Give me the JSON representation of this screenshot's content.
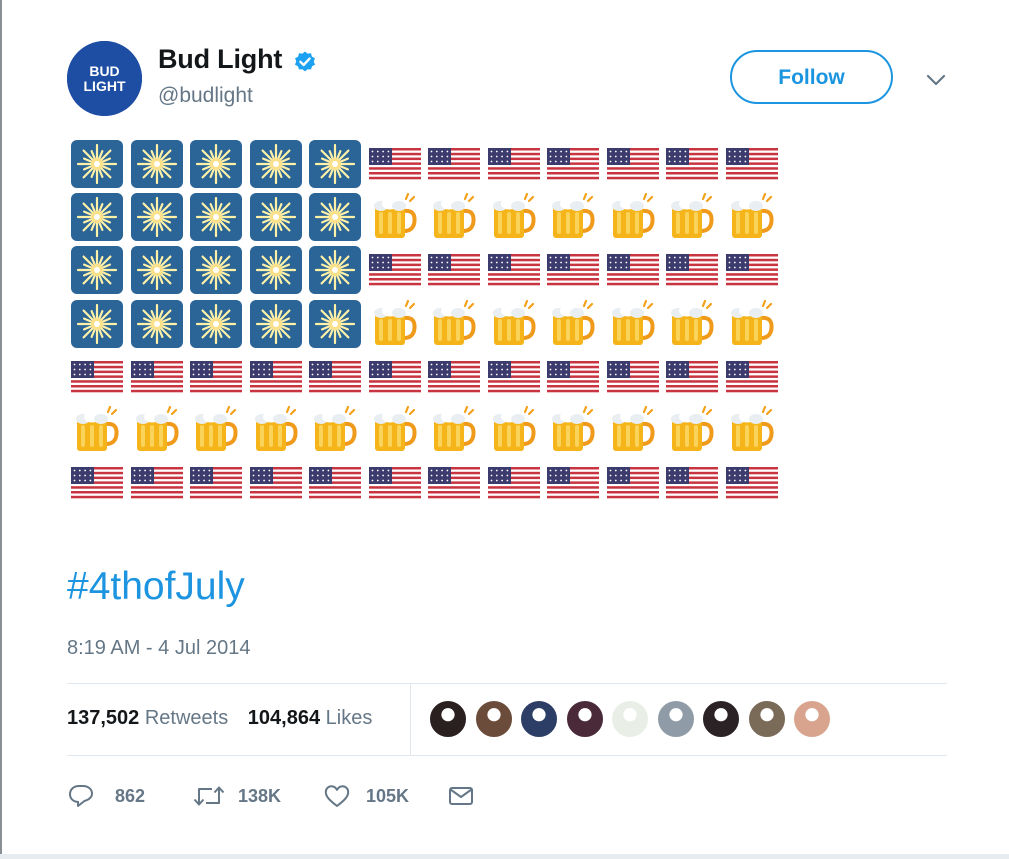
{
  "tweet": {
    "author": {
      "display_name": "Bud Light",
      "handle": "@budlight",
      "avatar_logo_text": [
        "BUD",
        "LIGHT"
      ],
      "avatar_color": "#1d4ea3",
      "verified": true,
      "verified_icon": "verified-badge-icon"
    },
    "follow_label": "Follow",
    "menu_icon": "chevron-down-icon",
    "emoji_flag": {
      "rows": [
        [
          "firework",
          "firework",
          "firework",
          "firework",
          "firework",
          "flag",
          "flag",
          "flag",
          "flag",
          "flag",
          "flag",
          "flag"
        ],
        [
          "firework",
          "firework",
          "firework",
          "firework",
          "firework",
          "beer",
          "beer",
          "beer",
          "beer",
          "beer",
          "beer",
          "beer"
        ],
        [
          "firework",
          "firework",
          "firework",
          "firework",
          "firework",
          "flag",
          "flag",
          "flag",
          "flag",
          "flag",
          "flag",
          "flag"
        ],
        [
          "firework",
          "firework",
          "firework",
          "firework",
          "firework",
          "beer",
          "beer",
          "beer",
          "beer",
          "beer",
          "beer",
          "beer"
        ],
        [
          "flag",
          "flag",
          "flag",
          "flag",
          "flag",
          "flag",
          "flag",
          "flag",
          "flag",
          "flag",
          "flag",
          "flag"
        ],
        [
          "beer",
          "beer",
          "beer",
          "beer",
          "beer",
          "beer",
          "beer",
          "beer",
          "beer",
          "beer",
          "beer",
          "beer"
        ],
        [
          "flag",
          "flag",
          "flag",
          "flag",
          "flag",
          "flag",
          "flag",
          "flag",
          "flag",
          "flag",
          "flag",
          "flag"
        ]
      ]
    },
    "hashtag": "#4thofJuly",
    "timestamp": "8:19 AM - 4 Jul 2014",
    "stats": {
      "retweets_count": "137,502",
      "retweets_label": "Retweets",
      "likes_count": "104,864",
      "likes_label": "Likes"
    },
    "liker_avatar_count": 9,
    "actions": [
      {
        "name": "reply",
        "icon": "reply-icon",
        "count": "862"
      },
      {
        "name": "retweet",
        "icon": "retweet-icon",
        "count": "138K"
      },
      {
        "name": "like",
        "icon": "heart-icon",
        "count": "105K"
      },
      {
        "name": "direct-message",
        "icon": "envelope-icon",
        "count": ""
      }
    ],
    "colors": {
      "accent": "#1b95e0",
      "hashtag": "#1c94e0",
      "muted_text": "#657786",
      "firework_tile": "#2b6496",
      "beer_gold": "#f4b41a",
      "flag_red": "#c8343f",
      "flag_blue": "#3c3b6e"
    }
  }
}
